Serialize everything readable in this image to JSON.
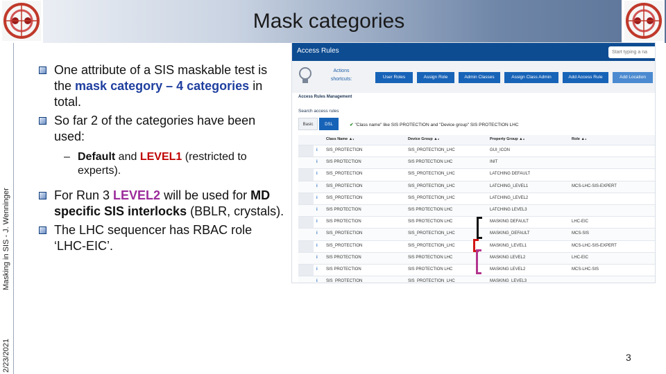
{
  "slide": {
    "title": "Mask categories",
    "footer_text": "Masking in SIS - J. Wenninger",
    "date": "2/23/2021",
    "page_number": "3"
  },
  "bullets": {
    "b1": {
      "pre": "One attribute of a SIS maskable test is the ",
      "hl1": "mask category",
      "mid": " – ",
      "hl2": "4 categories",
      "post": " in total."
    },
    "b2": {
      "text": "So far 2 of the categories have been used:"
    },
    "sub": {
      "dash": "–",
      "hl1": "Default",
      "mid": " and ",
      "hl2": "LEVEL1",
      "post": " (restricted to experts)."
    },
    "b3": {
      "pre": "For Run 3 ",
      "hl1": "LEVEL2",
      "mid": " will be used for ",
      "hl2": "MD specific SIS interlocks",
      "post": " (BBLR, crystals)."
    },
    "b4": {
      "text": "The LHC sequencer has RBAC role ‘LHC-EIC’."
    }
  },
  "app": {
    "title": "Access Rules",
    "search_placeholder": "Start typing a na",
    "shortcuts_label": "Actions shortcuts:",
    "buttons": [
      "User Roles",
      "Assign Role",
      "Admin Classes",
      "Assign Class Admin",
      "Add Access Rule",
      "Add Location"
    ],
    "section_heading": "Access Rules Management",
    "search_heading": "Search access rules",
    "tabs": [
      "Basic",
      "DSL"
    ],
    "filter_text": "\"Class name\" like SIS PROTECTION and \"Device group\"  SIS PROTECTION LHC",
    "columns": [
      "Class Name ▲₁",
      "Device Group ▲₂",
      "Property Group ▲₃",
      "Role ▲₄"
    ],
    "rows": [
      {
        "info": "i",
        "class": "SIS_PROTECTION",
        "device": "SIS_PROTECTION_LHC",
        "property": "GUI_ICON",
        "role": ""
      },
      {
        "info": "i",
        "class": "SIS PROTECTION",
        "device": "SIS PROTECTION LHC",
        "property": "INIT",
        "role": ""
      },
      {
        "info": "i",
        "class": "SIS_PROTECTION",
        "device": "SIS_PROTECTION_LHC",
        "property": "LATCHING DEFAULT",
        "role": ""
      },
      {
        "info": "i",
        "class": "SIS_PROTECTION",
        "device": "SIS_PROTECTION_LHC",
        "property": "LATCHING_LEVEL1",
        "role": "MCS-LHC-SIS-EXPERT"
      },
      {
        "info": "i",
        "class": "SIS_PROTECTION",
        "device": "SIS_PROTECTION_LHC",
        "property": "LATCHING_LEVEL2",
        "role": ""
      },
      {
        "info": "i",
        "class": "SIS PROTECTION",
        "device": "SIS PROTECTION LHC",
        "property": "LATCHING LEVEL3",
        "role": ""
      },
      {
        "info": "i",
        "class": "SIS PROTECTION",
        "device": "SIS PROTECTION LHC",
        "property": "MASKING DEFAULT",
        "role": "LHC-EIC"
      },
      {
        "info": "i",
        "class": "SIS_PROTECTION",
        "device": "SIS_PROTECTION_LHC",
        "property": "MASKING_DEFAULT",
        "role": "MCS-SIS"
      },
      {
        "info": "i",
        "class": "SIS_PROTECTION",
        "device": "SIS_PROTECTION_LHC",
        "property": "MASKING_LEVEL1",
        "role": "MCS-LHC-SIS-EXPERT"
      },
      {
        "info": "i",
        "class": "SIS PROTECTION",
        "device": "SIS PROTECTION LHC",
        "property": "MASKING LEVEL2",
        "role": "LHC-EIC"
      },
      {
        "info": "i",
        "class": "SIS PROTECTION",
        "device": "SIS PROTECTION LHC",
        "property": "MASKING LEVEL2",
        "role": "MCS-LHC-SIS"
      },
      {
        "info": "i",
        "class": "SIS_PROTECTION",
        "device": "SIS_PROTECTION_LHC",
        "property": "MASKING_LEVEL3",
        "role": ""
      }
    ]
  },
  "colors": {
    "highlight_blue": "#1f3f9f",
    "highlight_red": "#c00000",
    "highlight_purple": "#9b2b9b",
    "app_header": "#0e4c92",
    "button_blue": "#1763b8"
  }
}
